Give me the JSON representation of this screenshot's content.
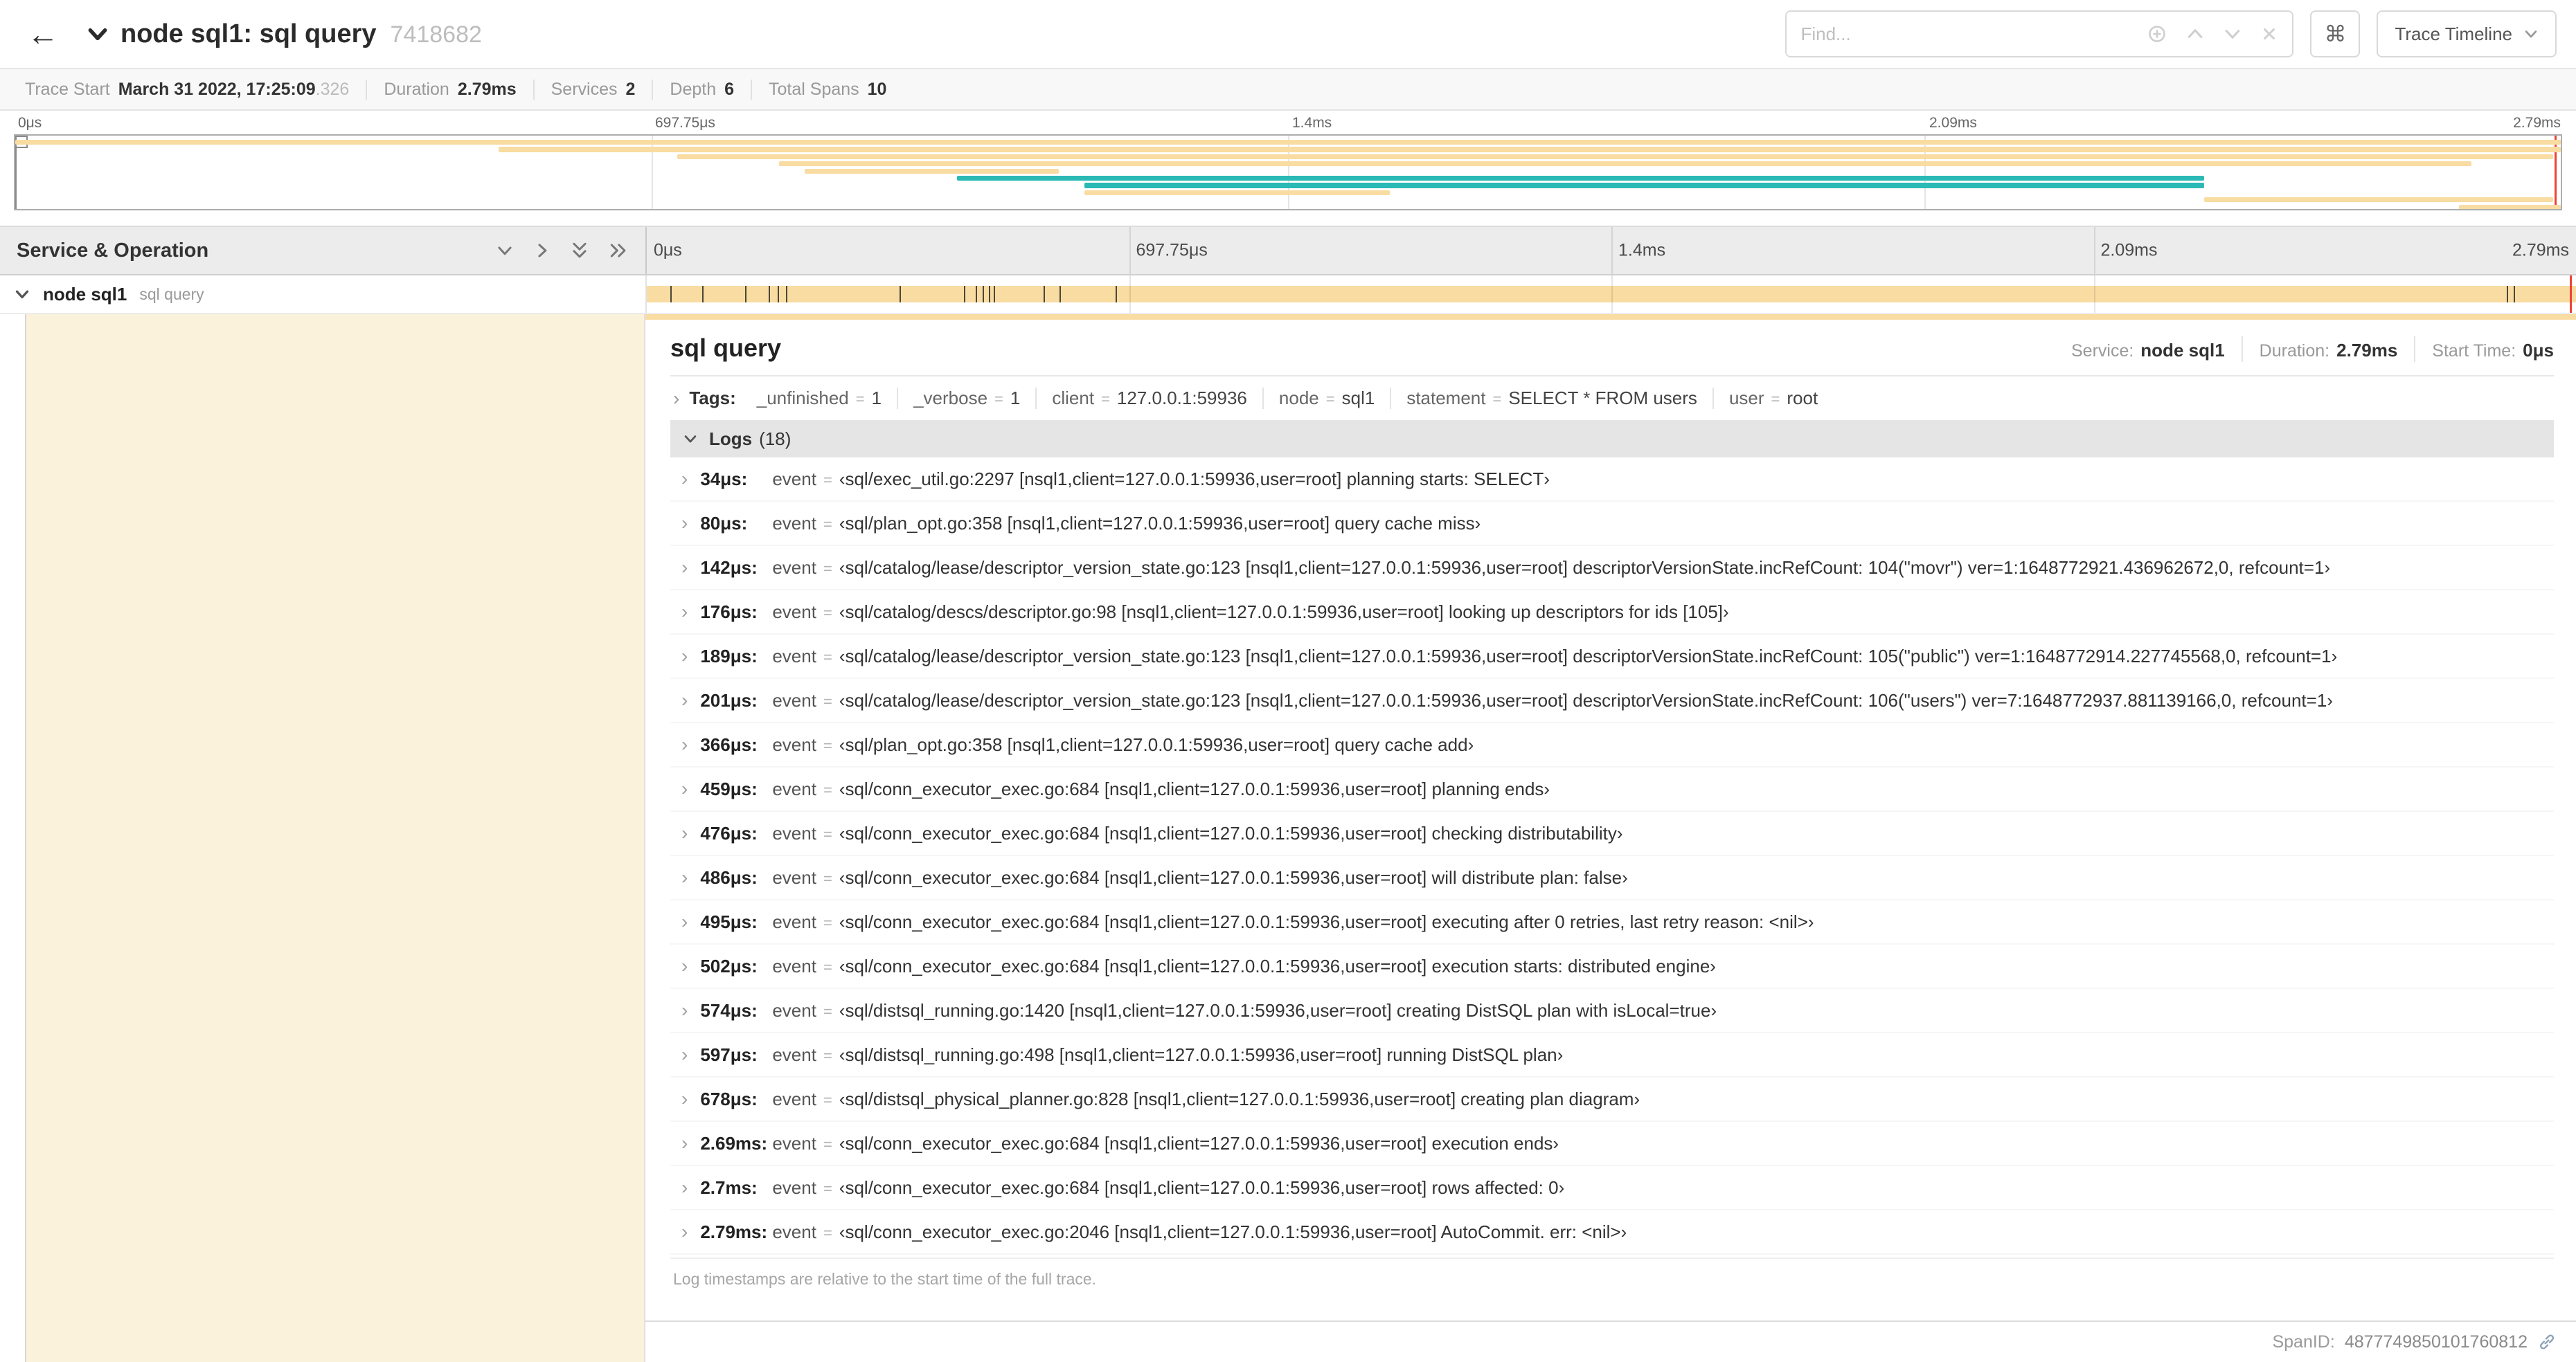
{
  "icons": {
    "back": "←",
    "keyboard_shortcuts": "⌘",
    "chevron_right": "›"
  },
  "colors": {
    "tan": "#f8dca2",
    "teal": "#2ab9b4",
    "cursor": "#ef4336",
    "selected_cream": "#fbf2db"
  },
  "header": {
    "title": "node sql1: sql query",
    "trace_id": "7418682",
    "find_placeholder": "Find...",
    "view_select_label": "Trace Timeline"
  },
  "summary": {
    "items": [
      {
        "label": "Trace Start",
        "value": "March 31 2022, 17:25:09",
        "suffix": ".326"
      },
      {
        "label": "Duration",
        "value": "2.79ms"
      },
      {
        "label": "Services",
        "value": "2"
      },
      {
        "label": "Depth",
        "value": "6"
      },
      {
        "label": "Total Spans",
        "value": "10"
      }
    ]
  },
  "timeline": {
    "ticks": [
      "0μs",
      "697.75μs",
      "1.4ms",
      "2.09ms",
      "2.79ms"
    ],
    "duration_us": 2790,
    "left_header": "Service & Operation",
    "span_row": {
      "service": "node sql1",
      "operation": "sql query"
    }
  },
  "minimap": {
    "spans": [
      {
        "start": 0,
        "end": 100,
        "color": "tan"
      },
      {
        "start": 19,
        "end": 100,
        "color": "tan"
      },
      {
        "start": 26,
        "end": 99.7,
        "color": "tan"
      },
      {
        "start": 30,
        "end": 96.5,
        "color": "tan"
      },
      {
        "start": 31,
        "end": 41,
        "color": "tan"
      },
      {
        "start": 37,
        "end": 86,
        "color": "teal"
      },
      {
        "start": 42,
        "end": 86,
        "color": "teal"
      },
      {
        "start": 42,
        "end": 54,
        "color": "tan"
      },
      {
        "start": 86,
        "end": 99.7,
        "color": "tan"
      },
      {
        "start": 96,
        "end": 100,
        "color": "tan"
      }
    ]
  },
  "detail": {
    "title": "sql query",
    "service_label": "Service:",
    "service": "node sql1",
    "duration_label": "Duration:",
    "duration": "2.79ms",
    "start_time_label": "Start Time:",
    "start_time": "0μs",
    "tags_label": "Tags:",
    "eq": "=",
    "tags": [
      {
        "key": "_unfinished",
        "value": "1"
      },
      {
        "key": "_verbose",
        "value": "1"
      },
      {
        "key": "client",
        "value": "127.0.0.1:59936"
      },
      {
        "key": "node",
        "value": "sql1"
      },
      {
        "key": "statement",
        "value": "SELECT * FROM users"
      },
      {
        "key": "user",
        "value": "root"
      }
    ],
    "logs_label": "Logs",
    "logs_count_display": "(18)",
    "log_key": "event",
    "logs": [
      {
        "t": "34μs:",
        "us": 34,
        "v": "‹sql/exec_util.go:2297 [nsql1,client=127.0.0.1:59936,user=root] planning starts: SELECT›"
      },
      {
        "t": "80μs:",
        "us": 80,
        "v": "‹sql/plan_opt.go:358 [nsql1,client=127.0.0.1:59936,user=root] query cache miss›"
      },
      {
        "t": "142μs:",
        "us": 142,
        "v": "‹sql/catalog/lease/descriptor_version_state.go:123 [nsql1,client=127.0.0.1:59936,user=root] descriptorVersionState.incRefCount: 104(\"movr\") ver=1:1648772921.436962672,0, refcount=1›"
      },
      {
        "t": "176μs:",
        "us": 176,
        "v": "‹sql/catalog/descs/descriptor.go:98 [nsql1,client=127.0.0.1:59936,user=root] looking up descriptors for ids [105]›"
      },
      {
        "t": "189μs:",
        "us": 189,
        "v": "‹sql/catalog/lease/descriptor_version_state.go:123 [nsql1,client=127.0.0.1:59936,user=root] descriptorVersionState.incRefCount: 105(\"public\") ver=1:1648772914.227745568,0, refcount=1›"
      },
      {
        "t": "201μs:",
        "us": 201,
        "v": "‹sql/catalog/lease/descriptor_version_state.go:123 [nsql1,client=127.0.0.1:59936,user=root] descriptorVersionState.incRefCount: 106(\"users\") ver=7:1648772937.881139166,0, refcount=1›"
      },
      {
        "t": "366μs:",
        "us": 366,
        "v": "‹sql/plan_opt.go:358 [nsql1,client=127.0.0.1:59936,user=root] query cache add›"
      },
      {
        "t": "459μs:",
        "us": 459,
        "v": "‹sql/conn_executor_exec.go:684 [nsql1,client=127.0.0.1:59936,user=root] planning ends›"
      },
      {
        "t": "476μs:",
        "us": 476,
        "v": "‹sql/conn_executor_exec.go:684 [nsql1,client=127.0.0.1:59936,user=root] checking distributability›"
      },
      {
        "t": "486μs:",
        "us": 486,
        "v": "‹sql/conn_executor_exec.go:684 [nsql1,client=127.0.0.1:59936,user=root] will distribute plan: false›"
      },
      {
        "t": "495μs:",
        "us": 495,
        "v": "‹sql/conn_executor_exec.go:684 [nsql1,client=127.0.0.1:59936,user=root] executing after 0 retries, last retry reason: <nil>›"
      },
      {
        "t": "502μs:",
        "us": 502,
        "v": "‹sql/conn_executor_exec.go:684 [nsql1,client=127.0.0.1:59936,user=root] execution starts: distributed engine›"
      },
      {
        "t": "574μs:",
        "us": 574,
        "v": "‹sql/distsql_running.go:1420 [nsql1,client=127.0.0.1:59936,user=root] creating DistSQL plan with isLocal=true›"
      },
      {
        "t": "597μs:",
        "us": 597,
        "v": "‹sql/distsql_running.go:498 [nsql1,client=127.0.0.1:59936,user=root] running DistSQL plan›"
      },
      {
        "t": "678μs:",
        "us": 678,
        "v": "‹sql/distsql_physical_planner.go:828 [nsql1,client=127.0.0.1:59936,user=root] creating plan diagram›"
      },
      {
        "t": "2.69ms:",
        "us": 2690,
        "v": "‹sql/conn_executor_exec.go:684 [nsql1,client=127.0.0.1:59936,user=root] execution ends›"
      },
      {
        "t": "2.7ms:",
        "us": 2700,
        "v": "‹sql/conn_executor_exec.go:684 [nsql1,client=127.0.0.1:59936,user=root] rows affected: 0›"
      },
      {
        "t": "2.79ms:",
        "us": 2790,
        "v": "‹sql/conn_executor_exec.go:2046 [nsql1,client=127.0.0.1:59936,user=root] AutoCommit. err: <nil>›"
      }
    ],
    "logs_note": "Log timestamps are relative to the start time of the full trace.",
    "span_id_label": "SpanID:",
    "span_id": "4877749850101760812"
  }
}
